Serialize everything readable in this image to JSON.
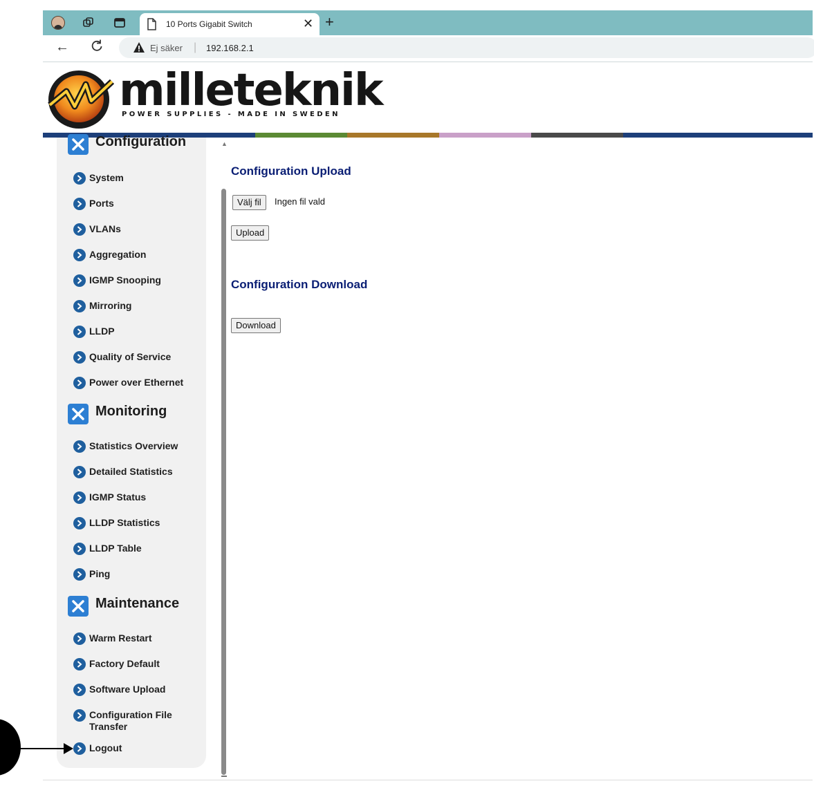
{
  "browser": {
    "tab_title": "10 Ports Gigabit Switch",
    "security_text": "Ej säker",
    "address_separator": "|",
    "url": "192.168.2.1"
  },
  "header": {
    "brand": "milleteknik",
    "tagline": "POWER SUPPLIES - MADE IN SWEDEN",
    "stripe_colors": [
      "#1d3f7a",
      "#5b8a34",
      "#a8782a",
      "#c9a0c8",
      "#4a4a4a",
      "#1d3f7a"
    ]
  },
  "sidebar": {
    "sections": [
      {
        "title": "Configuration",
        "items": [
          "System",
          "Ports",
          "VLANs",
          "Aggregation",
          "IGMP Snooping",
          "Mirroring",
          "LLDP",
          "Quality of Service",
          "Power over Ethernet"
        ]
      },
      {
        "title": "Monitoring",
        "items": [
          "Statistics Overview",
          "Detailed Statistics",
          "IGMP Status",
          "LLDP Statistics",
          "LLDP Table",
          "Ping"
        ]
      },
      {
        "title": "Maintenance",
        "items": [
          "Warm Restart",
          "Factory Default",
          "Software Upload",
          "Configuration File Transfer",
          "Logout"
        ]
      }
    ]
  },
  "main": {
    "upload_title": "Configuration Upload",
    "choose_file_label": "Välj fil",
    "file_status": "Ingen fil vald",
    "upload_button": "Upload",
    "download_title": "Configuration Download",
    "download_button": "Download"
  },
  "colors": {
    "accent_title": "#0a1e74",
    "nav_bullet": "#1f5f9e",
    "section_icon": "#2d7fd3",
    "tabbar": "#7fbcc1"
  }
}
